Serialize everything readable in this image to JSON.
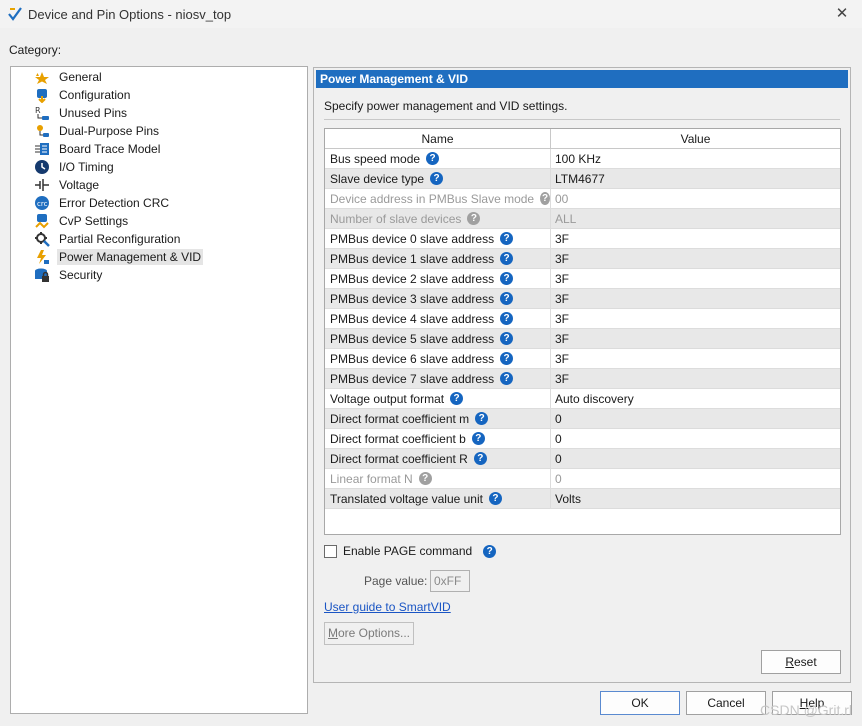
{
  "window": {
    "title": "Device and Pin Options - niosv_top",
    "close_glyph": "✕"
  },
  "category_label": "Category:",
  "tree": {
    "items": [
      {
        "label": "General",
        "icon": "general-icon"
      },
      {
        "label": "Configuration",
        "icon": "configuration-icon"
      },
      {
        "label": "Unused Pins",
        "icon": "unused-pins-icon"
      },
      {
        "label": "Dual-Purpose Pins",
        "icon": "dual-purpose-pins-icon"
      },
      {
        "label": "Board Trace Model",
        "icon": "board-trace-model-icon"
      },
      {
        "label": "I/O Timing",
        "icon": "io-timing-icon"
      },
      {
        "label": "Voltage",
        "icon": "voltage-icon"
      },
      {
        "label": "Error Detection CRC",
        "icon": "error-detection-crc-icon"
      },
      {
        "label": "CvP Settings",
        "icon": "cvp-settings-icon"
      },
      {
        "label": "Partial Reconfiguration",
        "icon": "partial-reconfiguration-icon"
      },
      {
        "label": "Power Management & VID",
        "icon": "power-management-icon",
        "selected": true
      },
      {
        "label": "Security",
        "icon": "security-icon"
      }
    ]
  },
  "panel": {
    "header": "Power Management & VID",
    "description": "Specify power management and VID settings.",
    "columns": {
      "name": "Name",
      "value": "Value"
    },
    "rows": [
      {
        "name": "Bus speed mode",
        "value": "100 KHz",
        "enabled": true
      },
      {
        "name": "Slave device type",
        "value": "LTM4677",
        "enabled": true
      },
      {
        "name": "Device address in PMBus Slave mode",
        "value": "00",
        "enabled": false
      },
      {
        "name": "Number of slave devices",
        "value": "ALL",
        "enabled": false
      },
      {
        "name": "PMBus device 0 slave address",
        "value": "3F",
        "enabled": true
      },
      {
        "name": "PMBus device 1 slave address",
        "value": "3F",
        "enabled": true
      },
      {
        "name": "PMBus device 2 slave address",
        "value": "3F",
        "enabled": true
      },
      {
        "name": "PMBus device 3 slave address",
        "value": "3F",
        "enabled": true
      },
      {
        "name": "PMBus device 4 slave address",
        "value": "3F",
        "enabled": true
      },
      {
        "name": "PMBus device 5 slave address",
        "value": "3F",
        "enabled": true
      },
      {
        "name": "PMBus device 6 slave address",
        "value": "3F",
        "enabled": true
      },
      {
        "name": "PMBus device 7 slave address",
        "value": "3F",
        "enabled": true
      },
      {
        "name": "Voltage output format",
        "value": "Auto discovery",
        "enabled": true
      },
      {
        "name": "Direct format coefficient m",
        "value": "0",
        "enabled": true
      },
      {
        "name": "Direct format coefficient b",
        "value": "0",
        "enabled": true
      },
      {
        "name": "Direct format coefficient R",
        "value": "0",
        "enabled": true
      },
      {
        "name": "Linear format N",
        "value": "0",
        "enabled": false
      },
      {
        "name": "Translated voltage value unit",
        "value": "Volts",
        "enabled": true
      }
    ],
    "help_glyph": "?",
    "enable_page_label": "Enable PAGE command",
    "enable_page_checked": false,
    "page_value_label": "Page value:",
    "page_value": "0xFF",
    "guide_link": "User guide to SmartVID",
    "more_options": {
      "mnemonic": "M",
      "rest": "ore Options..."
    },
    "reset": {
      "mnemonic": "R",
      "rest": "eset"
    }
  },
  "buttons": {
    "ok": "OK",
    "cancel": "Cancel",
    "help": {
      "mnemonic": "H",
      "rest": "elp"
    }
  },
  "watermark": "CSDN @Grit.rl",
  "colors": {
    "header_bg": "#1f6ec0",
    "help_icon": "#1565c0",
    "link": "#1a55c4"
  }
}
